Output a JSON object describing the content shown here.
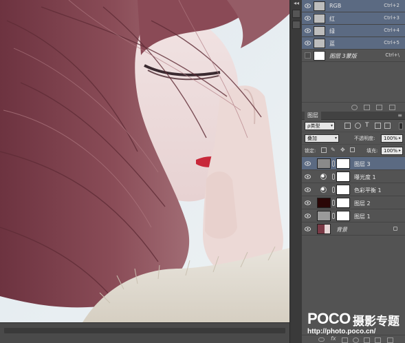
{
  "channels": {
    "items": [
      {
        "name": "RGB",
        "shortcut": "Ctrl+2"
      },
      {
        "name": "红",
        "shortcut": "Ctrl+3"
      },
      {
        "name": "绿",
        "shortcut": "Ctrl+4"
      },
      {
        "name": "蓝",
        "shortcut": "Ctrl+5"
      },
      {
        "name": "图层 3蒙版",
        "shortcut": "Ctrl+\\"
      }
    ]
  },
  "layers_panel": {
    "tab": "图层",
    "filter_kind": "ρ类型",
    "blend_mode": "叠加",
    "opacity_label": "不透明度:",
    "opacity_value": "100%",
    "lock_label": "锁定:",
    "fill_label": "填充:",
    "fill_value": "100%",
    "layers": [
      {
        "name": "图层 3",
        "selected": true,
        "kind": "pixel",
        "thumb_color": "#8a8a8a"
      },
      {
        "name": "曝光度 1",
        "selected": false,
        "kind": "adjustment"
      },
      {
        "name": "色彩平衡 1",
        "selected": false,
        "kind": "adjustment"
      },
      {
        "name": "图层 2",
        "selected": false,
        "kind": "pixel",
        "thumb_color": "#2a0606"
      },
      {
        "name": "图层 1",
        "selected": false,
        "kind": "pixel",
        "thumb_color": "#9a9a9a"
      },
      {
        "name": "背景",
        "selected": false,
        "kind": "background"
      }
    ],
    "footer_icons": [
      "link-icon",
      "fx-icon",
      "mask-icon",
      "adjustment-icon",
      "folder-icon",
      "new-layer-icon",
      "trash-icon"
    ]
  },
  "watermark": {
    "logo": "POCO",
    "title": "摄影专题",
    "url": "http://photo.poco.cn/"
  },
  "colors": {
    "selection": "#5b6a82",
    "panel": "#535353",
    "lip": "#c8283a",
    "hair": "#7a4048"
  }
}
